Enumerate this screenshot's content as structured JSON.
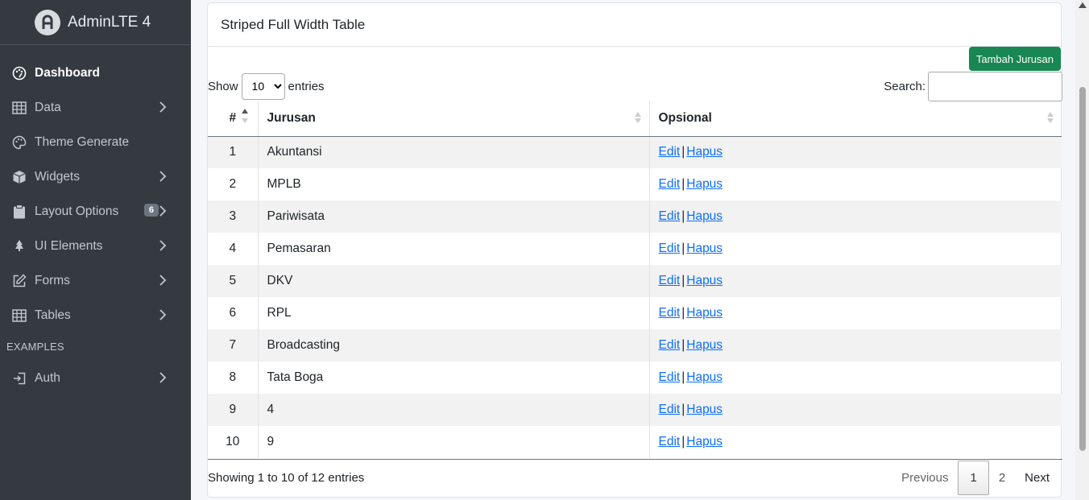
{
  "brand": {
    "name": "AdminLTE 4"
  },
  "sidebar": {
    "items": [
      {
        "label": "Dashboard",
        "icon": "palette-icon",
        "active": true
      },
      {
        "label": "Data",
        "icon": "table-icon"
      },
      {
        "label": "Theme Generate",
        "icon": "palette-icon"
      },
      {
        "label": "Widgets",
        "icon": "box-icon"
      },
      {
        "label": "Layout Options",
        "icon": "clipboard-icon",
        "badge": "6"
      },
      {
        "label": "UI Elements",
        "icon": "tree-icon"
      },
      {
        "label": "Forms",
        "icon": "pencil-square-icon"
      },
      {
        "label": "Tables",
        "icon": "table-icon"
      }
    ],
    "header": "EXAMPLES",
    "auth": {
      "label": "Auth",
      "icon": "box-arrow-in-right-icon"
    }
  },
  "card": {
    "title": "Striped Full Width Table",
    "add_button": "Tambah Jurusan"
  },
  "datatable": {
    "show_label": "Show",
    "entries_label": "entries",
    "entries_value": "10",
    "search_label": "Search:",
    "search_value": "",
    "columns": [
      "#",
      "Jurusan",
      "Opsional"
    ],
    "rows": [
      {
        "num": "1",
        "jurusan": "Akuntansi"
      },
      {
        "num": "2",
        "jurusan": "MPLB"
      },
      {
        "num": "3",
        "jurusan": "Pariwisata"
      },
      {
        "num": "4",
        "jurusan": "Pemasaran"
      },
      {
        "num": "5",
        "jurusan": "DKV"
      },
      {
        "num": "6",
        "jurusan": "RPL"
      },
      {
        "num": "7",
        "jurusan": "Broadcasting"
      },
      {
        "num": "8",
        "jurusan": "Tata Boga"
      },
      {
        "num": "9",
        "jurusan": "4"
      },
      {
        "num": "10",
        "jurusan": "9"
      }
    ],
    "edit_label": "Edit",
    "separator": "|",
    "delete_label": "Hapus",
    "info": "Showing 1 to 10 of 12 entries",
    "pagination": {
      "previous": "Previous",
      "pages": [
        "1",
        "2"
      ],
      "next": "Next"
    }
  }
}
